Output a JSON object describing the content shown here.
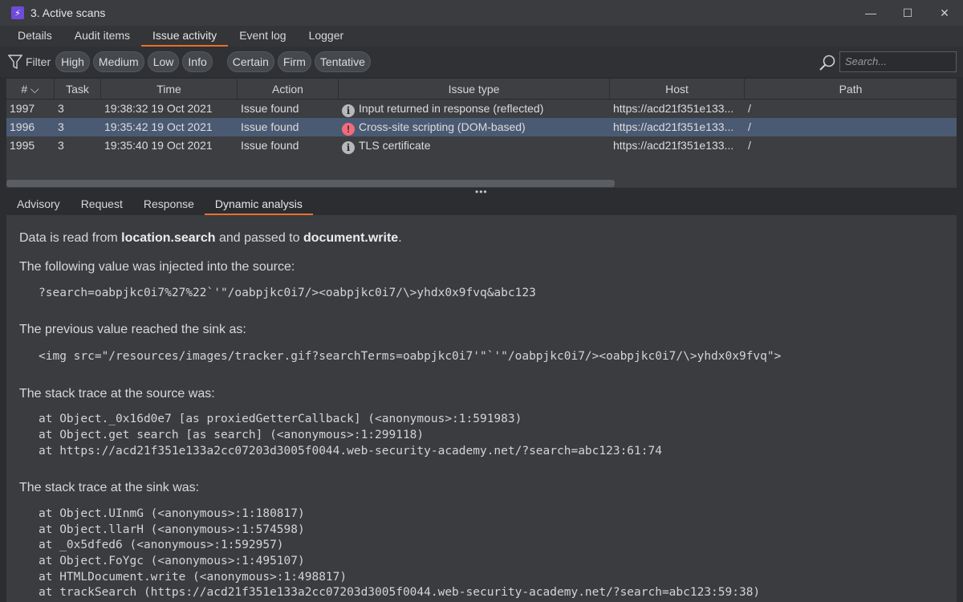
{
  "window": {
    "title": "3. Active scans",
    "app_icon_glyph": "⚡"
  },
  "window_controls": {
    "minimize": "—",
    "maximize": "☐",
    "close": "✕"
  },
  "top_tabs": [
    "Details",
    "Audit items",
    "Issue activity",
    "Event log",
    "Logger"
  ],
  "top_tabs_active": "Issue activity",
  "filter": {
    "label": "Filter",
    "severity": [
      "High",
      "Medium",
      "Low",
      "Info"
    ],
    "confidence": [
      "Certain",
      "Firm",
      "Tentative"
    ],
    "search_placeholder": "Search..."
  },
  "table": {
    "headers": [
      "# ⌵",
      "Task",
      "Time",
      "Action",
      "Issue type",
      "Host",
      "Path"
    ],
    "rows": [
      {
        "num": "1997",
        "task": "3",
        "time": "19:38:32 19 Oct 2021",
        "action": "Issue found",
        "icon": "info-icon",
        "issue": "Input returned in response (reflected)",
        "host": "https://acd21f351e133...",
        "path": "/",
        "selected": false
      },
      {
        "num": "1996",
        "task": "3",
        "time": "19:35:42 19 Oct 2021",
        "action": "Issue found",
        "icon": "high-severity-icon",
        "issue": "Cross-site scripting (DOM-based)",
        "host": "https://acd21f351e133...",
        "path": "/",
        "selected": true
      },
      {
        "num": "1995",
        "task": "3",
        "time": "19:35:40 19 Oct 2021",
        "action": "Issue found",
        "icon": "info-icon",
        "issue": "TLS certificate",
        "host": "https://acd21f351e133...",
        "path": "/",
        "selected": false
      }
    ]
  },
  "splitter": "•••",
  "lower_tabs": [
    "Advisory",
    "Request",
    "Response",
    "Dynamic analysis"
  ],
  "lower_tabs_active": "Dynamic analysis",
  "analysis": {
    "intro_prefix": "Data is read from ",
    "source": "location.search",
    "intro_mid": " and passed to ",
    "sink": "document.write",
    "intro_suffix": ".",
    "injected_heading": "The following value was injected into the source:",
    "injected_value": "?search=oabpjkc0i7%27%22`'\"/oabpjkc0i7/><oabpjkc0i7/\\>yhdx0x9fvq&abc123",
    "sink_heading": "The previous value reached the sink as:",
    "sink_value": "<img src=\"/resources/images/tracker.gif?searchTerms=oabpjkc0i7'\"`'\"/oabpjkc0i7/><oabpjkc0i7/\\>yhdx0x9fvq\">",
    "source_trace_heading": "The stack trace at the source was:",
    "source_trace": [
      "at Object._0x16d0e7 [as proxiedGetterCallback] (<anonymous>:1:591983)",
      "at Object.get search [as search] (<anonymous>:1:299118)",
      "at https://acd21f351e133a2cc07203d3005f0044.web-security-academy.net/?search=abc123:61:74"
    ],
    "sink_trace_heading": "The stack trace at the sink was:",
    "sink_trace": [
      "at Object.UInmG (<anonymous>:1:180817)",
      "at Object.llarH (<anonymous>:1:574598)",
      "at _0x5dfed6 (<anonymous>:1:592957)",
      "at Object.FoYgc (<anonymous>:1:495107)",
      "at HTMLDocument.write (<anonymous>:1:498817)",
      "at trackSearch (https://acd21f351e133a2cc07203d3005f0044.web-security-academy.net/?search=abc123:59:38)"
    ]
  }
}
